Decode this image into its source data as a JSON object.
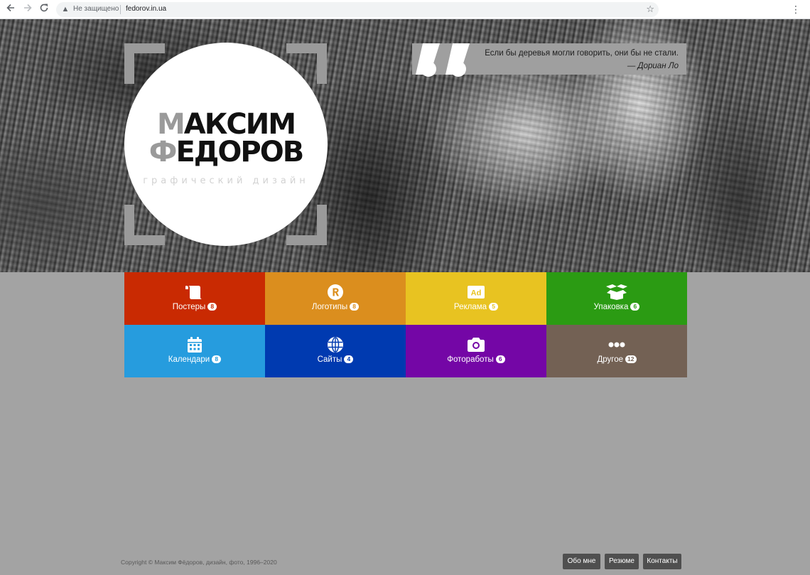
{
  "browser": {
    "back_icon": "arrow-left-icon",
    "forward_icon": "arrow-right-icon",
    "reload_icon": "reload-icon",
    "security_status": "Не защищено",
    "url": "fedorov.in.ua",
    "bookmark_icon": "star-icon",
    "menu_icon": "vertical-dots-icon"
  },
  "hero": {
    "logo": {
      "first_letter_1": "М",
      "rest_1": "АКСИМ",
      "first_letter_2": "Ф",
      "rest_2": "ЕДОРОВ",
      "subtitle": "графический дизайн"
    },
    "quote": {
      "marks": "“",
      "text": "Если бы деревья могли говорить, они бы не стали.",
      "author": "— Дориан Ло"
    }
  },
  "categories": [
    {
      "label": "Постеры",
      "count": "8",
      "icon": "scroll-icon",
      "color": "#c92a02"
    },
    {
      "label": "Логотипы",
      "count": "8",
      "icon": "registered-trademark-icon",
      "color": "#db8e1e"
    },
    {
      "label": "Реклама",
      "count": "5",
      "icon": "ad-icon",
      "color": "#e8c321"
    },
    {
      "label": "Упаковка",
      "count": "6",
      "icon": "box-open-icon",
      "color": "#2b9b13"
    },
    {
      "label": "Календари",
      "count": "8",
      "icon": "calendar-icon",
      "color": "#269cde"
    },
    {
      "label": "Сайты",
      "count": "4",
      "icon": "globe-icon",
      "color": "#003ab0"
    },
    {
      "label": "Фотоработы",
      "count": "6",
      "icon": "camera-icon",
      "color": "#7406a6"
    },
    {
      "label": "Другое",
      "count": "12",
      "icon": "ellipsis-icon",
      "color": "#736154"
    }
  ],
  "footer": {
    "copyright": "Copyright © Максим Фёдоров, дизайн, фото, 1996–2020",
    "about": "Обо мне",
    "resume": "Резюме",
    "contacts": "Контакты"
  },
  "colors": {
    "page_background": "#a3a3a3",
    "footer_button": "#4f4f4f",
    "logo_accent": "#9a9a9a"
  }
}
